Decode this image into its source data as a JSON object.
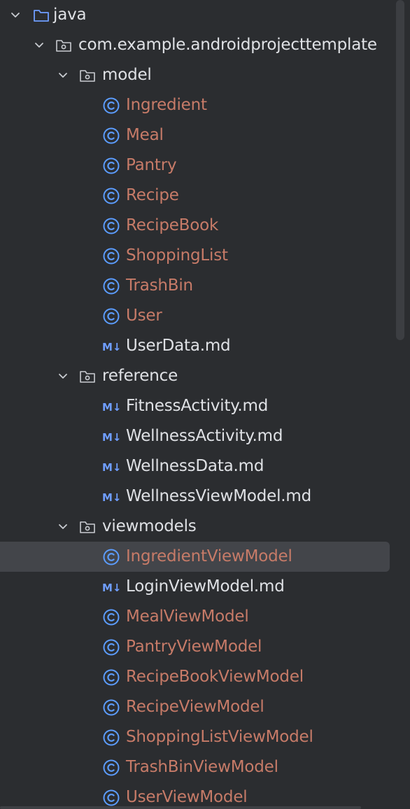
{
  "tree": [
    {
      "label": "java",
      "kind": "folder-blue",
      "level": 0,
      "expanded": true
    },
    {
      "label": "com.example.androidprojecttemplate",
      "kind": "package",
      "level": 1,
      "expanded": true
    },
    {
      "label": "model",
      "kind": "package",
      "level": 2,
      "expanded": true
    },
    {
      "label": "Ingredient",
      "kind": "class",
      "level": 3
    },
    {
      "label": "Meal",
      "kind": "class",
      "level": 3
    },
    {
      "label": "Pantry",
      "kind": "class",
      "level": 3
    },
    {
      "label": "Recipe",
      "kind": "class",
      "level": 3
    },
    {
      "label": "RecipeBook",
      "kind": "class",
      "level": 3
    },
    {
      "label": "ShoppingList",
      "kind": "class",
      "level": 3
    },
    {
      "label": "TrashBin",
      "kind": "class",
      "level": 3
    },
    {
      "label": "User",
      "kind": "class",
      "level": 3
    },
    {
      "label": "UserData.md",
      "kind": "markdown",
      "level": 3
    },
    {
      "label": "reference",
      "kind": "package",
      "level": 2,
      "expanded": true
    },
    {
      "label": "FitnessActivity.md",
      "kind": "markdown",
      "level": 3
    },
    {
      "label": "WellnessActivity.md",
      "kind": "markdown",
      "level": 3
    },
    {
      "label": "WellnessData.md",
      "kind": "markdown",
      "level": 3
    },
    {
      "label": "WellnessViewModel.md",
      "kind": "markdown",
      "level": 3
    },
    {
      "label": "viewmodels",
      "kind": "package",
      "level": 2,
      "expanded": true
    },
    {
      "label": "IngredientViewModel",
      "kind": "class",
      "level": 3,
      "selected": true
    },
    {
      "label": "LoginViewModel.md",
      "kind": "markdown",
      "level": 3
    },
    {
      "label": "MealViewModel",
      "kind": "class",
      "level": 3
    },
    {
      "label": "PantryViewModel",
      "kind": "class",
      "level": 3
    },
    {
      "label": "RecipeBookViewModel",
      "kind": "class",
      "level": 3
    },
    {
      "label": "RecipeViewModel",
      "kind": "class",
      "level": 3
    },
    {
      "label": "ShoppingListViewModel",
      "kind": "class",
      "level": 3
    },
    {
      "label": "TrashBinViewModel",
      "kind": "class",
      "level": 3
    },
    {
      "label": "UserViewModel",
      "kind": "class",
      "level": 3
    }
  ],
  "icons": {
    "class": "class-icon",
    "markdown": "markdown-icon",
    "package": "package-folder-icon",
    "folder-blue": "source-folder-icon",
    "expanded": "chevron-down-icon"
  },
  "colors": {
    "background": "#2b2d30",
    "selection": "#43454a",
    "class_text": "#c77b68",
    "plain_text": "#dfe1e5",
    "class_icon": "#5c9dff",
    "markdown_icon": "#6f9eff",
    "folder_blue": "#6f9eff",
    "arrow": "#c9ccd1"
  }
}
